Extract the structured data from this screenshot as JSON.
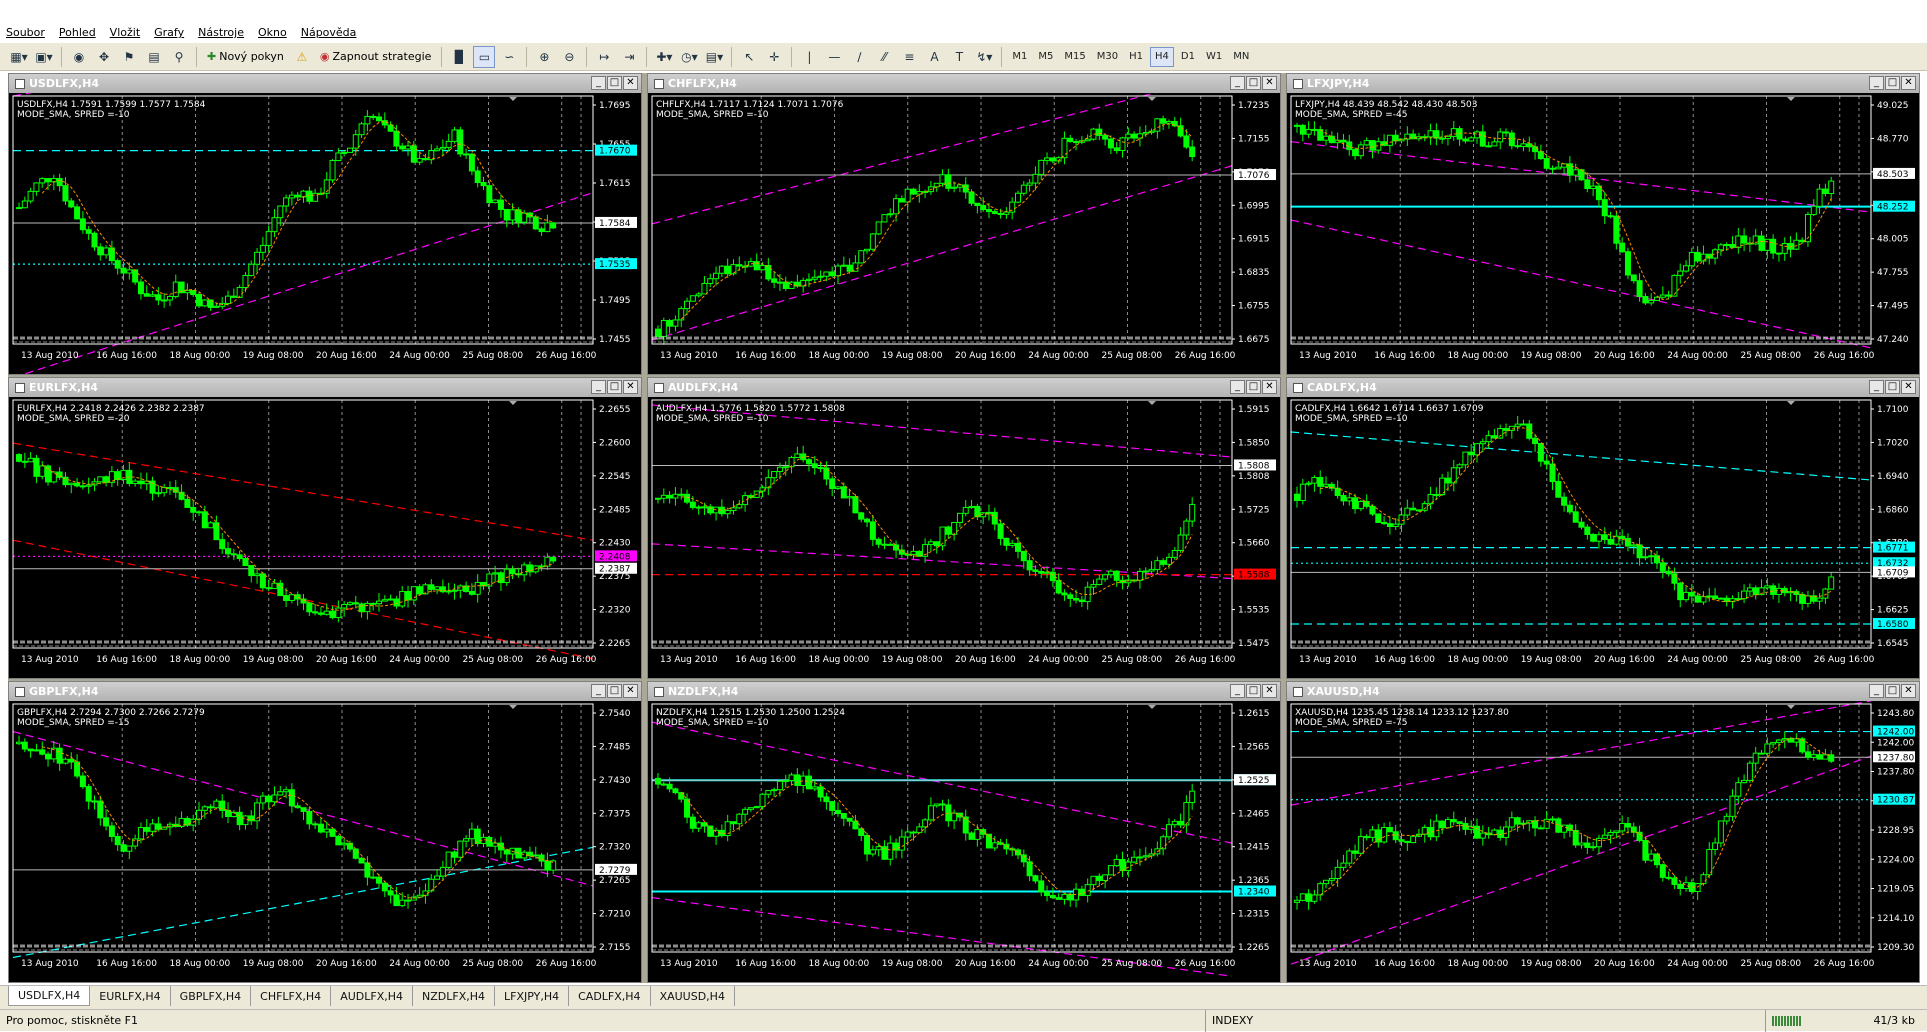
{
  "menu": [
    "Soubor",
    "Pohled",
    "Vložit",
    "Grafy",
    "Nástroje",
    "Okno",
    "Nápověda"
  ],
  "toolbar": {
    "new_order_label": "Nový pokyn",
    "strategy_label": "Zapnout strategie",
    "timeframes": [
      "M1",
      "M5",
      "M15",
      "M30",
      "H1",
      "H4",
      "D1",
      "W1",
      "MN"
    ],
    "active_timeframe": "H4",
    "text_tool_label": "A",
    "label_tool_label": "T"
  },
  "colors": {
    "chart_bg": "#000000",
    "candle": "#00ff00",
    "grid": "#c8c8c8",
    "axis_text": "#ffffff",
    "ma_line": "#ff8c00",
    "channel_magenta": "#ff00ff",
    "channel_cyan": "#00ffff",
    "channel_red": "#ff0000",
    "title_text": "#ffffff"
  },
  "time_labels": [
    "13 Aug 2010",
    "16 Aug 16:00",
    "18 Aug 00:00",
    "19 Aug 08:00",
    "20 Aug 16:00",
    "24 Aug 00:00",
    "25 Aug 08:00",
    "26 Aug 16:00"
  ],
  "windows": [
    {
      "title": "USDLFX,H4",
      "info": "USDLFX,H4  1.7591 1.7599 1.7577 1.7584",
      "mode": "MODE_SMA, SPRED =-10",
      "prices": [
        "1.7695",
        "1.7655",
        "1.7615",
        "1.7575",
        "1.7535",
        "1.7495",
        "1.7455"
      ],
      "min": 1.744,
      "max": 1.7735,
      "current": 1.7584,
      "current_label": "1.7584",
      "hlines": [
        {
          "v": 1.767,
          "label": "1.7670",
          "c": "cyan"
        },
        {
          "v": 1.7535,
          "label": "1.7535",
          "c": "cyan",
          "dot": true
        }
      ],
      "trend": "up",
      "lines": [
        {
          "a": 1.7735,
          "b": 1.786,
          "c": "magenta"
        },
        {
          "a": 1.74,
          "b": 1.762,
          "c": "magenta"
        }
      ],
      "path": [
        0.55,
        0.64,
        0.69,
        0.55,
        0.44,
        0.36,
        0.3,
        0.22,
        0.18,
        0.24,
        0.2,
        0.14,
        0.18,
        0.28,
        0.4,
        0.56,
        0.62,
        0.58,
        0.72,
        0.8,
        0.94,
        0.86,
        0.8,
        0.72,
        0.78,
        0.84,
        0.7,
        0.6,
        0.52,
        0.52,
        0.48,
        0.5
      ]
    },
    {
      "title": "CHFLFX,H4",
      "info": "CHFLFX,H4  1.7117 1.7124 1.7071 1.7076",
      "mode": "MODE_SMA, SPRED =-10",
      "prices": [
        "1.7235",
        "1.7155",
        "1.7076",
        "1.6995",
        "1.6915",
        "1.6835",
        "1.6755",
        "1.6675"
      ],
      "min": 1.664,
      "max": 1.728,
      "current": 1.7076,
      "current_label": "1.7076",
      "hlines": [],
      "trend": "up",
      "lines": [
        {
          "a": 1.695,
          "b": 1.734,
          "c": "magenta"
        },
        {
          "a": 1.665,
          "b": 1.71,
          "c": "magenta"
        }
      ],
      "path": [
        0.06,
        0.12,
        0.2,
        0.26,
        0.3,
        0.34,
        0.3,
        0.22,
        0.24,
        0.26,
        0.28,
        0.3,
        0.4,
        0.52,
        0.6,
        0.62,
        0.66,
        0.64,
        0.58,
        0.52,
        0.54,
        0.62,
        0.72,
        0.78,
        0.84,
        0.86,
        0.8,
        0.82,
        0.88,
        0.9,
        0.84,
        0.74
      ]
    },
    {
      "title": "LFXJPY,H4",
      "info": "LFXJPY,H4  48.439 48.542 48.430 48.503",
      "mode": "MODE_SMA, SPRED =-45",
      "prices": [
        "49.025",
        "48.770",
        "48.503",
        "48.252",
        "48.005",
        "47.755",
        "47.495",
        "47.240"
      ],
      "min": 47.2,
      "max": 49.1,
      "current": 48.503,
      "current_label": "48.503",
      "hlines": [
        {
          "v": 48.252,
          "label": "48.252",
          "c": "cyan",
          "thick": true
        }
      ],
      "trend": "down",
      "lines": [
        {
          "a": 48.75,
          "b": 48.21,
          "c": "magenta"
        },
        {
          "a": 48.15,
          "b": 47.17,
          "c": "magenta"
        }
      ],
      "path": [
        0.88,
        0.86,
        0.8,
        0.78,
        0.8,
        0.82,
        0.84,
        0.82,
        0.84,
        0.86,
        0.84,
        0.82,
        0.84,
        0.8,
        0.74,
        0.72,
        0.7,
        0.62,
        0.5,
        0.3,
        0.16,
        0.18,
        0.3,
        0.36,
        0.38,
        0.4,
        0.42,
        0.4,
        0.38,
        0.44,
        0.6,
        0.7
      ]
    },
    {
      "title": "EURLFX,H4",
      "info": "EURLFX,H4  2.2418 2.2426 2.2382 2.2387",
      "mode": "MODE_SMA, SPRED =-20",
      "prices": [
        "2.2655",
        "2.2600",
        "2.2545",
        "2.2485",
        "2.2430",
        "2.2375",
        "2.2320",
        "2.2265"
      ],
      "min": 2.224,
      "max": 2.27,
      "current": 2.2387,
      "current_label": "2.2387",
      "hlines": [
        {
          "v": 2.241,
          "label": "2.2408",
          "c": "magenta",
          "dot": true,
          "bg": "#ff00ff"
        }
      ],
      "trend": "down",
      "lines": [
        {
          "a": 2.262,
          "b": 2.244,
          "c": "red"
        },
        {
          "a": 2.244,
          "b": 2.222,
          "c": "red"
        }
      ],
      "path": [
        0.78,
        0.72,
        0.68,
        0.66,
        0.66,
        0.68,
        0.7,
        0.66,
        0.64,
        0.62,
        0.56,
        0.48,
        0.4,
        0.32,
        0.26,
        0.22,
        0.18,
        0.16,
        0.14,
        0.18,
        0.16,
        0.18,
        0.2,
        0.24,
        0.22,
        0.26,
        0.24,
        0.28,
        0.3,
        0.32,
        0.34,
        0.36
      ]
    },
    {
      "title": "AUDLFX,H4",
      "info": "AUDLFX,H4  1.5776 1.5820 1.5772 1.5808",
      "mode": "MODE_SMA, SPRED =-10",
      "prices": [
        "1.5915",
        "1.5850",
        "1.5808",
        "1.5725",
        "1.5660",
        "1.5600",
        "1.5535",
        "1.5475"
      ],
      "min": 1.544,
      "max": 1.594,
      "current": 1.5808,
      "current_label": "1.5808",
      "hlines": [
        {
          "v": 1.5588,
          "label": "1.5588",
          "c": "red",
          "bg": "#ff0000"
        }
      ],
      "trend": "side",
      "lines": [
        {
          "a": 1.593,
          "b": 1.5825,
          "c": "magenta"
        },
        {
          "a": 1.565,
          "b": 1.558,
          "c": "magenta"
        }
      ],
      "path": [
        0.6,
        0.62,
        0.58,
        0.54,
        0.58,
        0.62,
        0.66,
        0.74,
        0.8,
        0.72,
        0.66,
        0.6,
        0.5,
        0.4,
        0.36,
        0.38,
        0.44,
        0.5,
        0.56,
        0.52,
        0.44,
        0.34,
        0.3,
        0.24,
        0.2,
        0.24,
        0.28,
        0.26,
        0.3,
        0.34,
        0.44,
        0.64
      ]
    },
    {
      "title": "CADLFX,H4",
      "info": "CADLFX,H4  1.6642 1.6714 1.6637 1.6709",
      "mode": "MODE_SMA, SPRED =-10",
      "prices": [
        "1.7100",
        "1.7020",
        "1.6940",
        "1.6860",
        "1.6780",
        "1.6709",
        "1.6625",
        "1.6545"
      ],
      "min": 1.652,
      "max": 1.714,
      "current": 1.6709,
      "current_label": "1.6709",
      "hlines": [
        {
          "v": 1.6771,
          "label": "1.6771",
          "c": "cyan"
        },
        {
          "v": 1.6732,
          "label": "1.6732",
          "c": "cyan",
          "dot": true
        },
        {
          "v": 1.658,
          "label": "1.6580",
          "c": "cyan"
        }
      ],
      "trend": "down",
      "lines": [
        {
          "a": 1.706,
          "b": 1.694,
          "c": "cyan"
        }
      ],
      "path": [
        0.62,
        0.66,
        0.64,
        0.6,
        0.56,
        0.5,
        0.52,
        0.58,
        0.64,
        0.72,
        0.8,
        0.86,
        0.9,
        0.88,
        0.76,
        0.62,
        0.52,
        0.46,
        0.44,
        0.42,
        0.38,
        0.3,
        0.22,
        0.2,
        0.18,
        0.2,
        0.22,
        0.24,
        0.22,
        0.2,
        0.22,
        0.3
      ]
    },
    {
      "title": "GBPLFX,H4",
      "info": "GBPLFX,H4  2.7294 2.7300 2.7266 2.7279",
      "mode": "MODE_SMA, SPRED =-15",
      "prices": [
        "2.7540",
        "2.7485",
        "2.7430",
        "2.7375",
        "2.7320",
        "2.7265",
        "2.7210",
        "2.7155"
      ],
      "min": 2.713,
      "max": 2.758,
      "current": 2.7279,
      "current_label": "2.7279",
      "hlines": [],
      "trend": "down",
      "lines": [
        {
          "a": 2.753,
          "b": 2.725,
          "c": "magenta"
        },
        {
          "a": 2.712,
          "b": 2.732,
          "c": "cyan"
        }
      ],
      "path": [
        0.84,
        0.82,
        0.8,
        0.76,
        0.62,
        0.5,
        0.42,
        0.48,
        0.52,
        0.5,
        0.56,
        0.6,
        0.54,
        0.52,
        0.6,
        0.66,
        0.58,
        0.52,
        0.46,
        0.4,
        0.3,
        0.24,
        0.2,
        0.24,
        0.32,
        0.4,
        0.48,
        0.42,
        0.4,
        0.38,
        0.36,
        0.34
      ]
    },
    {
      "title": "NZDLFX,H4",
      "info": "NZDLFX,H4  1.2515 1.2530 1.2500 1.2524",
      "mode": "MODE_SMA, SPRED =-10",
      "prices": [
        "1.2615",
        "1.2565",
        "1.2524",
        "1.2465",
        "1.2415",
        "1.2365",
        "1.2315",
        "1.2265"
      ],
      "min": 1.224,
      "max": 1.265,
      "current": 1.2524,
      "current_label": "1.2525",
      "hlines": [
        {
          "v": 1.2524,
          "label": "1.2525",
          "c": "cyan",
          "thick": true
        },
        {
          "v": 1.234,
          "label": "1.2340",
          "c": "cyan",
          "thick": true
        }
      ],
      "trend": "down",
      "lines": [
        {
          "a": 1.262,
          "b": 1.242,
          "c": "magenta"
        },
        {
          "a": 1.233,
          "b": 1.22,
          "c": "magenta"
        }
      ],
      "path": [
        0.7,
        0.62,
        0.52,
        0.46,
        0.5,
        0.56,
        0.62,
        0.68,
        0.7,
        0.66,
        0.6,
        0.5,
        0.42,
        0.4,
        0.46,
        0.52,
        0.58,
        0.54,
        0.48,
        0.44,
        0.4,
        0.36,
        0.26,
        0.22,
        0.24,
        0.28,
        0.34,
        0.36,
        0.4,
        0.46,
        0.54,
        0.66
      ]
    },
    {
      "title": "XAUUSD,H4",
      "info": "XAUUSD,H4  1235.45 1238.14 1233.12 1237.80",
      "mode": "MODE_SMA, SPRED =-75",
      "prices": [
        "1243.80",
        "1242.00",
        "1237.80",
        "1233.90",
        "1228.95",
        "1224.00",
        "1219.05",
        "1214.10",
        "1209.30"
      ],
      "min": 1206.0,
      "max": 1246.5,
      "current": 1237.8,
      "current_label": "1237.80",
      "hlines": [
        {
          "v": 1242.0,
          "label": "1242.00",
          "c": "cyan"
        },
        {
          "v": 1230.87,
          "label": "1230.87",
          "c": "cyan",
          "dot": true
        }
      ],
      "trend": "up",
      "lines": [
        {
          "a": 1230.0,
          "b": 1247.0,
          "c": "magenta"
        },
        {
          "a": 1204.0,
          "b": 1238.0,
          "c": "magenta"
        }
      ],
      "path": [
        0.2,
        0.24,
        0.3,
        0.4,
        0.46,
        0.48,
        0.46,
        0.48,
        0.5,
        0.52,
        0.48,
        0.46,
        0.5,
        0.54,
        0.52,
        0.5,
        0.46,
        0.44,
        0.48,
        0.5,
        0.4,
        0.3,
        0.24,
        0.28,
        0.46,
        0.62,
        0.76,
        0.84,
        0.88,
        0.82,
        0.78,
        0.8
      ]
    }
  ],
  "tabs": [
    "USDLFX,H4",
    "EURLFX,H4",
    "GBPLFX,H4",
    "CHFLFX,H4",
    "AUDLFX,H4",
    "NZDLFX,H4",
    "LFXJPY,H4",
    "CADLFX,H4",
    "XAUUSD,H4"
  ],
  "active_tab": "USDLFX,H4",
  "status": {
    "help": "Pro pomoc, stiskněte F1",
    "profile": "INDEXY",
    "traffic": "41/3 kb"
  }
}
